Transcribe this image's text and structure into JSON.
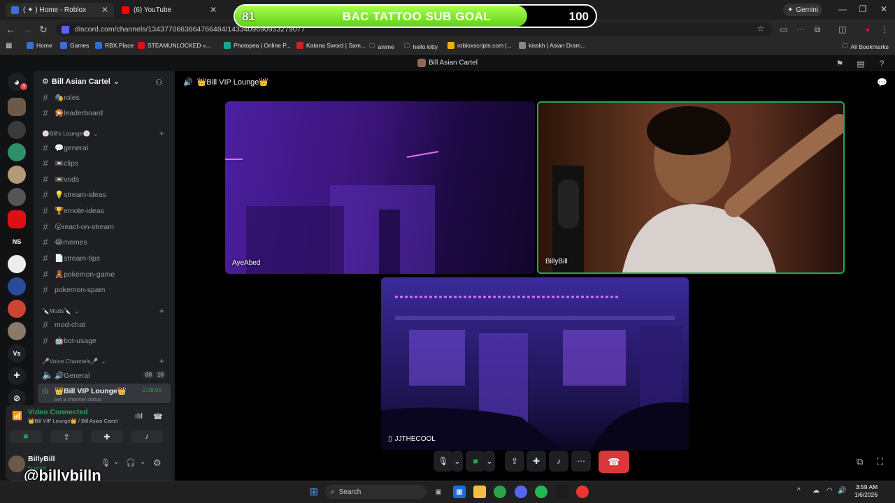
{
  "browser": {
    "tabs": [
      {
        "title": "( ✦ ) Home - Roblox",
        "color": "#3b6fd8"
      },
      {
        "title": "(6) YouTube",
        "color": "#ff0000"
      }
    ],
    "gemini_label": "Gemini",
    "url": "discord.com/channels/1343770663864766484/1433409690953279077",
    "bookmarks": [
      {
        "label": "Home",
        "color": "#3b6fd8"
      },
      {
        "label": "Games",
        "color": "#3b6fd8"
      },
      {
        "label": "RBX.Place",
        "color": "#2a6fd6"
      },
      {
        "label": "STEAMUNLOCKED »...",
        "color": "#d11"
      },
      {
        "label": "Photopea | Online P...",
        "color": "#18a497"
      },
      {
        "label": "Katana Sword | Sam...",
        "color": "#c22"
      },
      {
        "label": "anime",
        "color": "folder"
      },
      {
        "label": "hello kitty",
        "color": "folder"
      },
      {
        "label": "robloxscripts.com |...",
        "color": "#f0b400"
      },
      {
        "label": "kisskh | Asian Dram...",
        "color": "#888"
      }
    ],
    "all_bookmarks": "All Bookmarks"
  },
  "goal": {
    "start": "81",
    "title": "BAC TATTOO SUB GOAL",
    "end": "100",
    "progress": 0.81
  },
  "discord": {
    "server_title": "Bill Asian Cartel",
    "server_name": "Bill Asian Cartel",
    "top_channels": [
      {
        "label": "🎭roles"
      },
      {
        "label": "🎇leaderboard"
      }
    ],
    "categories": [
      {
        "label": "🍥Bill's Lounge🍥",
        "channels": [
          "💬general",
          "📼clips",
          "📼vods",
          "💡stream-ideas",
          "🏆emote-ideas",
          "😮react-on-stream",
          "😂memes",
          "📄stream-tips",
          "🧸pokémon-game",
          "pokemon-spam"
        ]
      },
      {
        "label": "🔪Mods🔪",
        "channels": [
          "mod-chat",
          "🤖bot-usage"
        ]
      }
    ],
    "voice_category": "🎤Voice Channels🎤",
    "voice_channels": [
      {
        "label": "🔊General",
        "badge_left": "00",
        "badge_right": "10"
      },
      {
        "label": "👑Bill VIP Lounge👑",
        "time": "2:08:00",
        "status": "Set a channel status"
      }
    ],
    "voice_status": "Video Connected",
    "voice_location": "👑Bill VIP Lounge👑 / Bill Asian Cartel",
    "user": {
      "name": "BillyBill",
      "status": "In voice"
    },
    "stage_title": "👑Bill VIP Lounge👑",
    "participants": [
      "AyeAbed",
      "BillyBill",
      "JJTHECOOL"
    ],
    "watermark": "@billybilln"
  },
  "taskbar": {
    "search": "Search",
    "time": "3:59 AM",
    "date": "1/6/2026"
  },
  "colors": {
    "accent": "#5865f2",
    "connected": "#23a55a",
    "hangup": "#da373c",
    "goal_fill": "#7be02f"
  }
}
